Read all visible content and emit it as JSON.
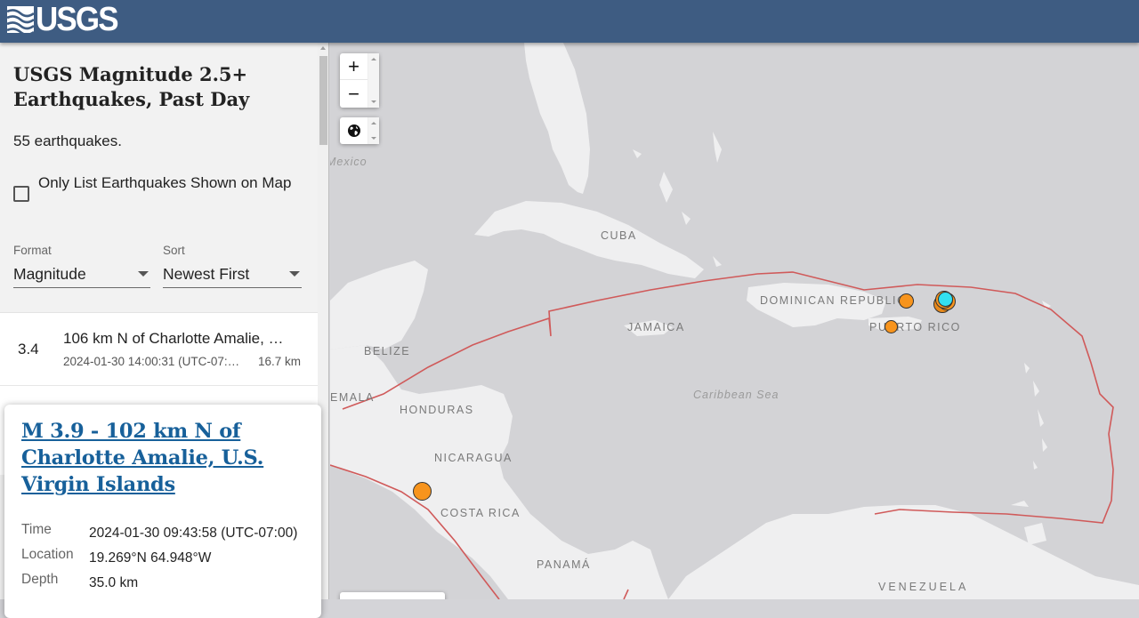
{
  "header": {
    "logo_text": "USGS"
  },
  "sidebar": {
    "title": "USGS Magnitude 2.5+ Earthquakes, Past Day",
    "count_text": "55 earthquakes.",
    "only_list_checkbox": {
      "label": "Only List Earthquakes Shown on Map",
      "checked": false
    },
    "format": {
      "label": "Format",
      "value": "Magnitude"
    },
    "sort": {
      "label": "Sort",
      "value": "Newest First"
    },
    "list": [
      {
        "magnitude": "3.4",
        "place": "106 km N of Charlotte Amalie, …",
        "time": "2024-01-30 14:00:31 (UTC-07:…",
        "depth": "16.7 km"
      }
    ]
  },
  "popup": {
    "title": "M 3.9 - 102 km N of Charlotte Amalie, U.S. Virgin Islands",
    "rows": [
      {
        "key": "Time",
        "value": "2024-01-30 09:43:58 (UTC-07:00)"
      },
      {
        "key": "Location",
        "value": "19.269°N 64.948°W"
      },
      {
        "key": "Depth",
        "value": "35.0 km"
      }
    ]
  },
  "map": {
    "controls": {
      "zoom_in": "+",
      "zoom_out": "−",
      "layers_icon": "globe-icon"
    },
    "labels": [
      {
        "id": "cuba",
        "text": "CUBA"
      },
      {
        "id": "dominican-republic",
        "text": "DOMINICAN REPUBLIC"
      },
      {
        "id": "puerto-rico",
        "text": "PUERTO RICO"
      },
      {
        "id": "jamaica",
        "text": "JAMAICA"
      },
      {
        "id": "belize",
        "text": "BELIZE"
      },
      {
        "id": "guatemala",
        "text": "EMALA"
      },
      {
        "id": "honduras",
        "text": "HONDURAS"
      },
      {
        "id": "nicaragua",
        "text": "NICARAGUA"
      },
      {
        "id": "costa-rica",
        "text": "COSTA RICA"
      },
      {
        "id": "panama",
        "text": "PANAMÁ"
      },
      {
        "id": "venezuela",
        "text": "VENEZUELA"
      },
      {
        "id": "caribbean-sea",
        "text": "Caribbean Sea"
      },
      {
        "id": "gulf-of-mexico",
        "text": "Mexico"
      }
    ],
    "colors": {
      "quake_orange": "#f7941d",
      "quake_selected": "#33e0f0",
      "plate_boundary": "#d05a5a",
      "land": "#efeff0",
      "water": "#d3d3d6"
    }
  }
}
